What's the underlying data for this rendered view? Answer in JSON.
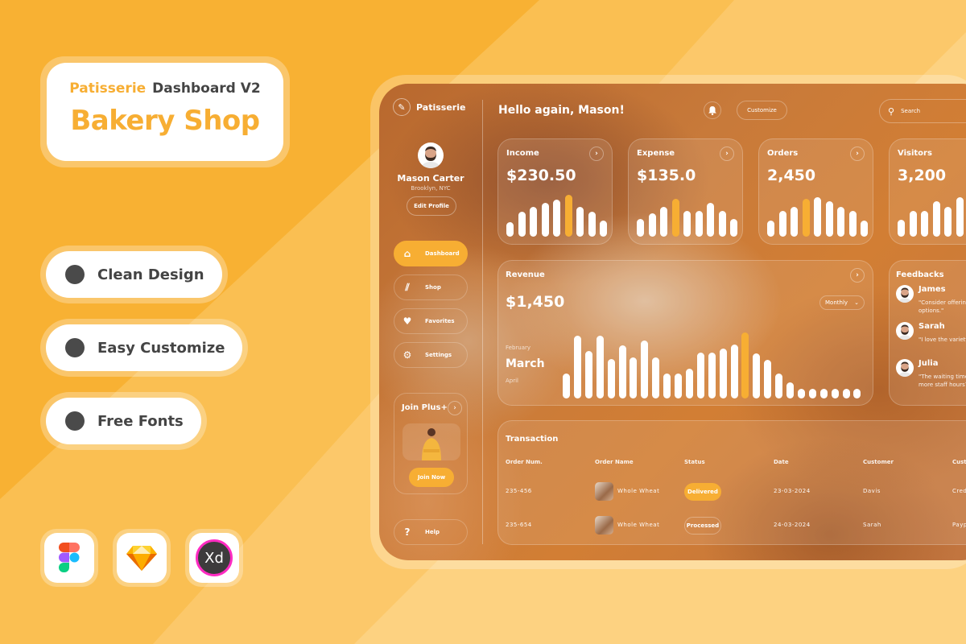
{
  "promo": {
    "brand": "Patisserie",
    "subtitle": "Dashboard V2",
    "title": "Bakery Shop",
    "features": [
      "Clean Design",
      "Easy Customize",
      "Free Fonts"
    ],
    "tools": [
      "figma-icon",
      "sketch-icon",
      "xd-icon"
    ],
    "xd_label": "Xd"
  },
  "colors": {
    "accent": "#f7ae33",
    "background": "#f8b133",
    "text_dark": "#444444",
    "bar": "#ffffff"
  },
  "sidebar": {
    "logo_text": "Patisserie",
    "profile": {
      "name": "Mason Carter",
      "location": "Brooklyn, NYC",
      "edit_label": "Edit Profile"
    },
    "nav": [
      {
        "label": "Dashboard",
        "icon": "home-icon",
        "active": true
      },
      {
        "label": "Shop",
        "icon": "shop-icon",
        "active": false
      },
      {
        "label": "Favorites",
        "icon": "heart-icon",
        "active": false
      },
      {
        "label": "Settings",
        "icon": "gear-icon",
        "active": false
      }
    ],
    "join": {
      "title": "Join Plus+",
      "button": "Join Now"
    },
    "help_label": "Help"
  },
  "header": {
    "greeting": "Hello again, Mason!",
    "customize_label": "Customize",
    "search_placeholder": "Search"
  },
  "stats": [
    {
      "title": "Income",
      "value": "$230.50",
      "bars": [
        0.35,
        0.6,
        0.72,
        0.8,
        0.88,
        1.0,
        0.72,
        0.6,
        0.38
      ],
      "highlight": 5
    },
    {
      "title": "Expense",
      "value": "$135.0",
      "bars": [
        0.42,
        0.55,
        0.72,
        0.9,
        0.62,
        0.62,
        0.8,
        0.62,
        0.42
      ],
      "highlight": 3
    },
    {
      "title": "Orders",
      "value": "2,450",
      "bars": [
        0.38,
        0.62,
        0.72,
        0.9,
        0.95,
        0.85,
        0.72,
        0.62,
        0.38
      ],
      "highlight": 3
    },
    {
      "title": "Visitors",
      "value": "3,200",
      "bars": [
        0.4,
        0.62,
        0.62,
        0.85,
        0.72,
        0.95
      ],
      "highlight": -1
    }
  ],
  "revenue": {
    "title": "Revenue",
    "value": "$1,450",
    "period": "Monthly",
    "months": {
      "prev": "February",
      "current": "March",
      "next": "April"
    },
    "bars": [
      0.38,
      0.95,
      0.72,
      0.95,
      0.6,
      0.8,
      0.62,
      0.88,
      0.62,
      0.38,
      0.38,
      0.45,
      0.7,
      0.7,
      0.75,
      0.82,
      1.0,
      0.68,
      0.58,
      0.38,
      0.24,
      0.15,
      0.15,
      0.15,
      0.15,
      0.15,
      0.15
    ],
    "highlight": 16
  },
  "feedbacks": {
    "title": "Feedbacks",
    "items": [
      {
        "name": "James",
        "text": "\"Consider offering free options.\""
      },
      {
        "name": "Sarah",
        "text": "\"I love the variety you offer.\""
      },
      {
        "name": "Julia",
        "text": "\"The waiting time, maybe more staff hours?\""
      }
    ]
  },
  "transactions": {
    "title": "Transaction",
    "columns": [
      "Order Num.",
      "Order Name",
      "Status",
      "Date",
      "Customer",
      "Custo"
    ],
    "rows": [
      {
        "order_num": "235-456",
        "order_name": "Whole Wheat",
        "status": "Delivered",
        "date": "23-03-2024",
        "customer": "Davis",
        "payment": "Cred"
      },
      {
        "order_num": "235-654",
        "order_name": "Whole Wheat",
        "status": "Processed",
        "date": "24-03-2024",
        "customer": "Sarah",
        "payment": "Payp"
      }
    ]
  }
}
